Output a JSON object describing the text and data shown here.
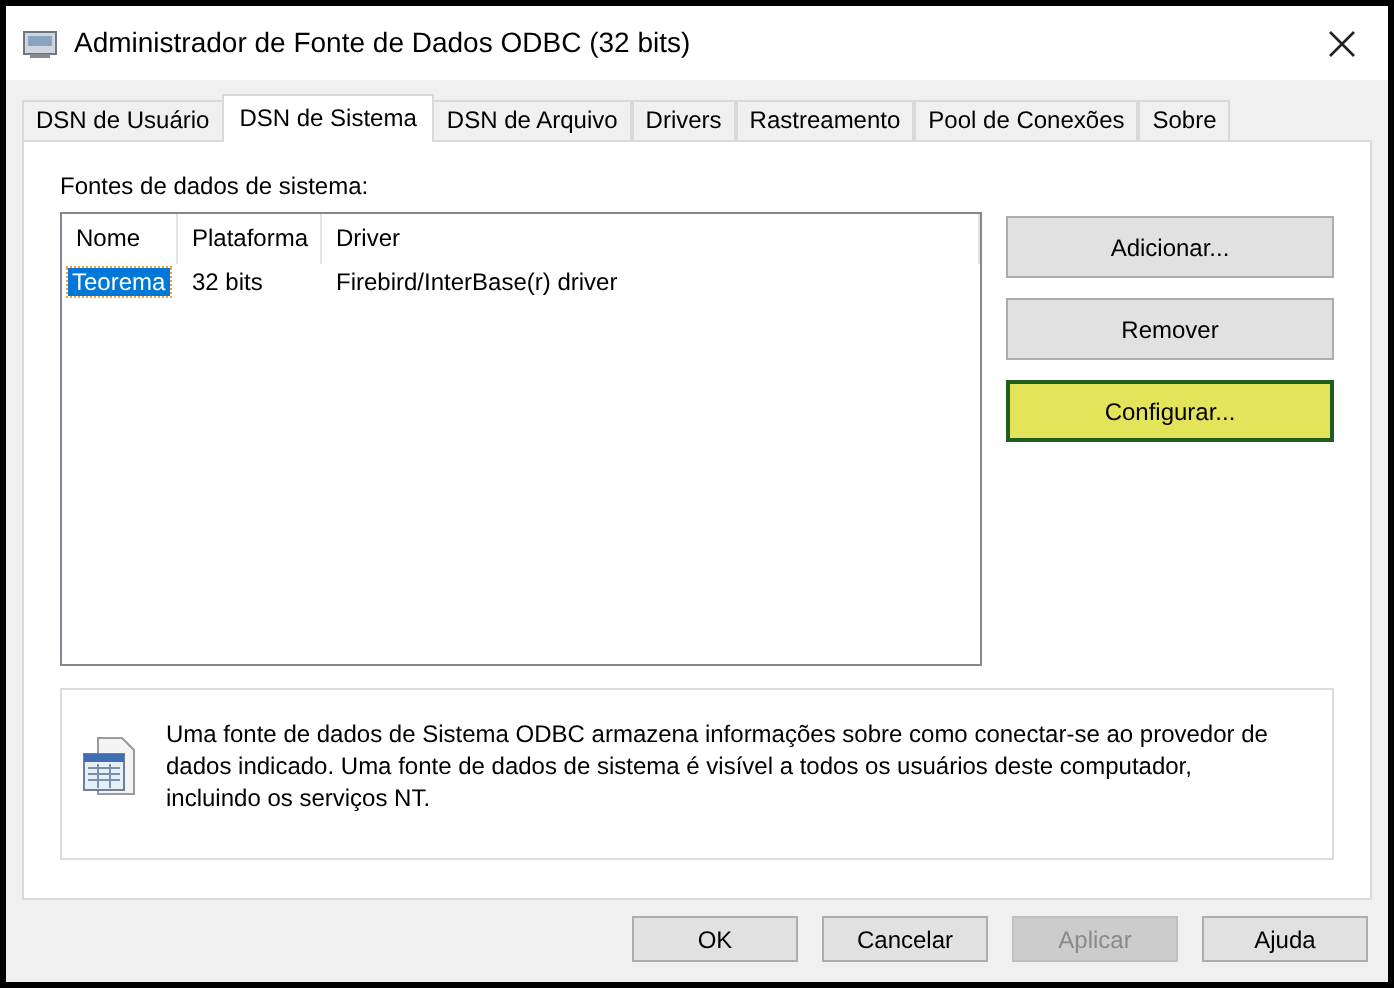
{
  "window": {
    "title": "Administrador de Fonte de Dados ODBC (32 bits)"
  },
  "tabs": [
    {
      "label": "DSN de Usuário",
      "selected": false
    },
    {
      "label": "DSN de Sistema",
      "selected": true
    },
    {
      "label": "DSN de Arquivo",
      "selected": false
    },
    {
      "label": "Drivers",
      "selected": false
    },
    {
      "label": "Rastreamento",
      "selected": false
    },
    {
      "label": "Pool de Conexões",
      "selected": false
    },
    {
      "label": "Sobre",
      "selected": false
    }
  ],
  "list_label": "Fontes de dados de sistema:",
  "table": {
    "columns": [
      "Nome",
      "Plataforma",
      "Driver"
    ],
    "rows": [
      {
        "cells": [
          "Teorema",
          "32 bits",
          "Firebird/InterBase(r) driver"
        ],
        "selected": true
      }
    ]
  },
  "side_buttons": [
    {
      "label": "Adicionar...",
      "highlighted": false
    },
    {
      "label": "Remover",
      "highlighted": false
    },
    {
      "label": "Configurar...",
      "highlighted": true
    }
  ],
  "info": "Uma fonte de dados de Sistema ODBC armazena informações sobre como conectar-se ao provedor de dados indicado. Uma fonte de dados de sistema é visível a todos os usuários deste computador, incluindo os serviços NT.",
  "buttons": [
    {
      "label": "OK",
      "disabled": false
    },
    {
      "label": "Cancelar",
      "disabled": false
    },
    {
      "label": "Aplicar",
      "disabled": true
    },
    {
      "label": "Ajuda",
      "disabled": false
    }
  ]
}
